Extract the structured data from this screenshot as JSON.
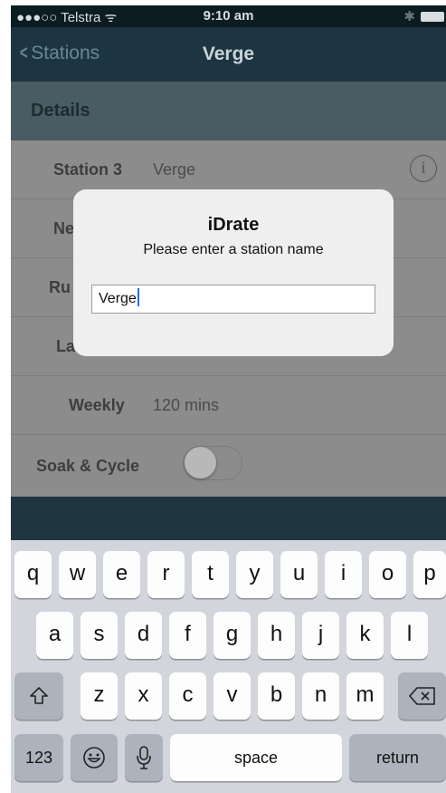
{
  "status_bar": {
    "carrier": "●●●○○ Telstra ᯤ",
    "time": "9:10 am",
    "bluetooth": "✱"
  },
  "nav": {
    "back_label": "Stations",
    "title": "Verge"
  },
  "details": {
    "header": "Details",
    "rows": [
      {
        "label": "Station 3",
        "value": "Verge"
      },
      {
        "label": "Ne",
        "value": ""
      },
      {
        "label": "Ru",
        "value": ""
      },
      {
        "label": "La",
        "value": ""
      },
      {
        "label": "Weekly",
        "value": "120 mins"
      },
      {
        "label": "Soak & Cycle",
        "value": ""
      }
    ],
    "soak_cycle_on": false
  },
  "alert": {
    "title": "iDrate",
    "message": "Please enter a station name",
    "field_value": "Verge"
  },
  "keyboard": {
    "row1": [
      "q",
      "w",
      "e",
      "r",
      "t",
      "y",
      "u",
      "i",
      "o",
      "p"
    ],
    "row2": [
      "a",
      "s",
      "d",
      "f",
      "g",
      "h",
      "j",
      "k",
      "l"
    ],
    "row3": [
      "z",
      "x",
      "c",
      "v",
      "b",
      "n",
      "m"
    ],
    "numbers_label": "123",
    "space_label": "space",
    "return_label": "return"
  },
  "icons": {
    "back": "chevron-left-icon",
    "info": "info-icon",
    "shift": "shift-icon",
    "delete": "delete-icon",
    "emoji": "emoji-icon",
    "mic": "microphone-icon"
  },
  "colors": {
    "nav_bg": "#1d3540",
    "keyboard_bg": "#d2d5db",
    "caret": "#1c6ef2"
  }
}
